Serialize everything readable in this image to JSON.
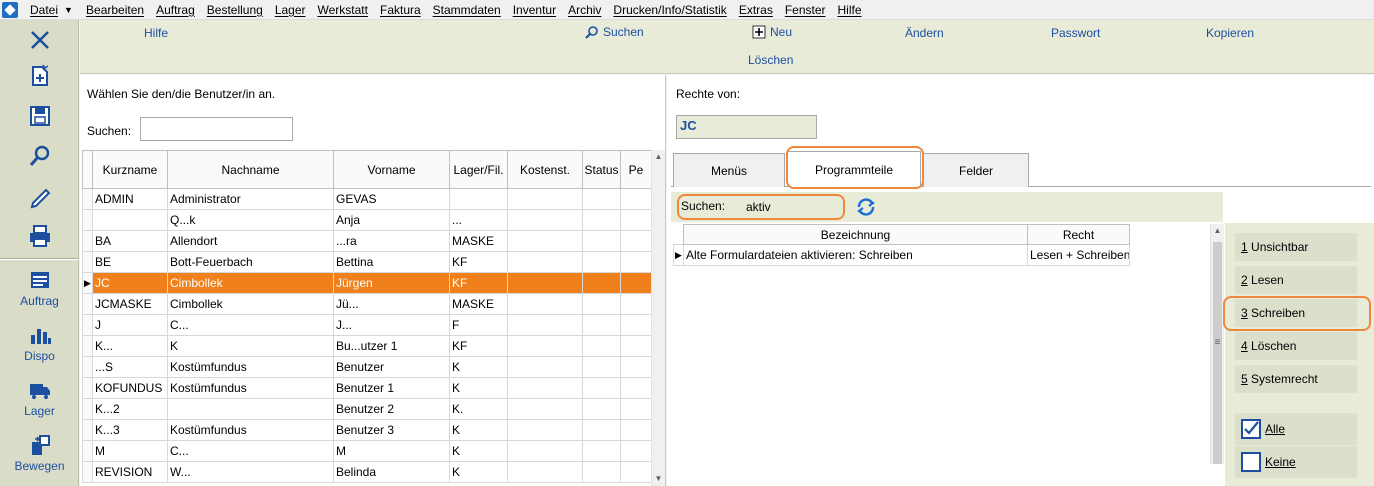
{
  "menubar": {
    "items": [
      "Datei",
      "Bearbeiten",
      "Auftrag",
      "Bestellung",
      "Lager",
      "Werkstatt",
      "Faktura",
      "Stammdaten",
      "Inventur",
      "Archiv",
      "Drucken/Info/Statistik",
      "Extras",
      "Fenster",
      "Hilfe"
    ]
  },
  "sidebar": {
    "items": [
      {
        "label": "Auftrag",
        "icon": "order-icon"
      },
      {
        "label": "Dispo",
        "icon": "bar-chart-icon"
      },
      {
        "label": "Lager",
        "icon": "truck-icon"
      },
      {
        "label": "Bewegen",
        "icon": "move-icon"
      }
    ]
  },
  "toolbar": {
    "hilfe": "Hilfe",
    "suchen": "Suchen",
    "neu": "Neu",
    "aendern": "Ändern",
    "passwort": "Passwort",
    "kopieren": "Kopieren",
    "loeschen": "Löschen"
  },
  "left": {
    "prompt": "Wählen Sie den/die Benutzer/in an.",
    "search_label": "Suchen:",
    "search_value": "",
    "columns": [
      "Kurzname",
      "Nachname",
      "Vorname",
      "Lager/Fil.",
      "Kostenst.",
      "Status",
      "Pe"
    ],
    "rows": [
      [
        "ADMIN",
        "Administrator",
        "GEVAS",
        "",
        "",
        "",
        ""
      ],
      [
        "",
        "Q...k",
        "Anja",
        "...",
        "",
        "",
        ""
      ],
      [
        "BA",
        "Allendort",
        "...ra",
        "MASKE",
        "",
        "",
        ""
      ],
      [
        "BE",
        "Bott-Feuerbach",
        "Bettina",
        "KF",
        "",
        "",
        ""
      ],
      [
        "JC",
        "Cimbollek",
        "Jürgen",
        "KF",
        "",
        "",
        ""
      ],
      [
        "JCMASKE",
        "Cimbollek",
        "Jü...",
        "MASKE",
        "",
        "",
        ""
      ],
      [
        "J",
        "C...",
        "J...",
        "F",
        "",
        "",
        ""
      ],
      [
        "K...",
        "K",
        "Bu...utzer 1",
        "KF",
        "",
        "",
        ""
      ],
      [
        "...S",
        "Kostümfundus",
        "Benutzer",
        "K",
        "",
        "",
        ""
      ],
      [
        "KOFUNDUS",
        "Kostümfundus",
        "Benutzer 1",
        "K",
        "",
        "",
        ""
      ],
      [
        "K...2",
        "",
        "Benutzer 2",
        "K.",
        "",
        "",
        ""
      ],
      [
        "K...3",
        "Kostümfundus",
        "Benutzer 3",
        "K",
        "",
        "",
        ""
      ],
      [
        "M",
        "C...",
        "M",
        "K",
        "",
        "",
        ""
      ],
      [
        "REVISION",
        "W...",
        "Belinda",
        "K",
        "",
        "",
        ""
      ]
    ],
    "selected_index": 4
  },
  "right": {
    "rights_of_label": "Rechte von:",
    "rights_of_value": "JC",
    "tabs": [
      "Menüs",
      "Programmteile",
      "Felder"
    ],
    "active_tab": 1,
    "search_label": "Suchen:",
    "search_value": "aktiv",
    "columns": [
      "Bezeichnung",
      "Recht"
    ],
    "rows": [
      [
        "Alte Formulardateien aktivieren: Schreiben",
        "Lesen + Schreiben"
      ]
    ],
    "buttons": [
      {
        "num": "1",
        "label": "Unsichtbar"
      },
      {
        "num": "2",
        "label": "Lesen"
      },
      {
        "num": "3",
        "label": "Schreiben"
      },
      {
        "num": "4",
        "label": "Löschen"
      },
      {
        "num": "5",
        "label": "Systemrecht"
      }
    ],
    "select_all": "Alle",
    "select_none": "Keine"
  },
  "colors": {
    "accent_orange": "#f0801c",
    "link_blue": "#1d4fa0",
    "sidebar_bg": "#d9ddc8",
    "toolbar_bg": "#e8ebd8"
  }
}
